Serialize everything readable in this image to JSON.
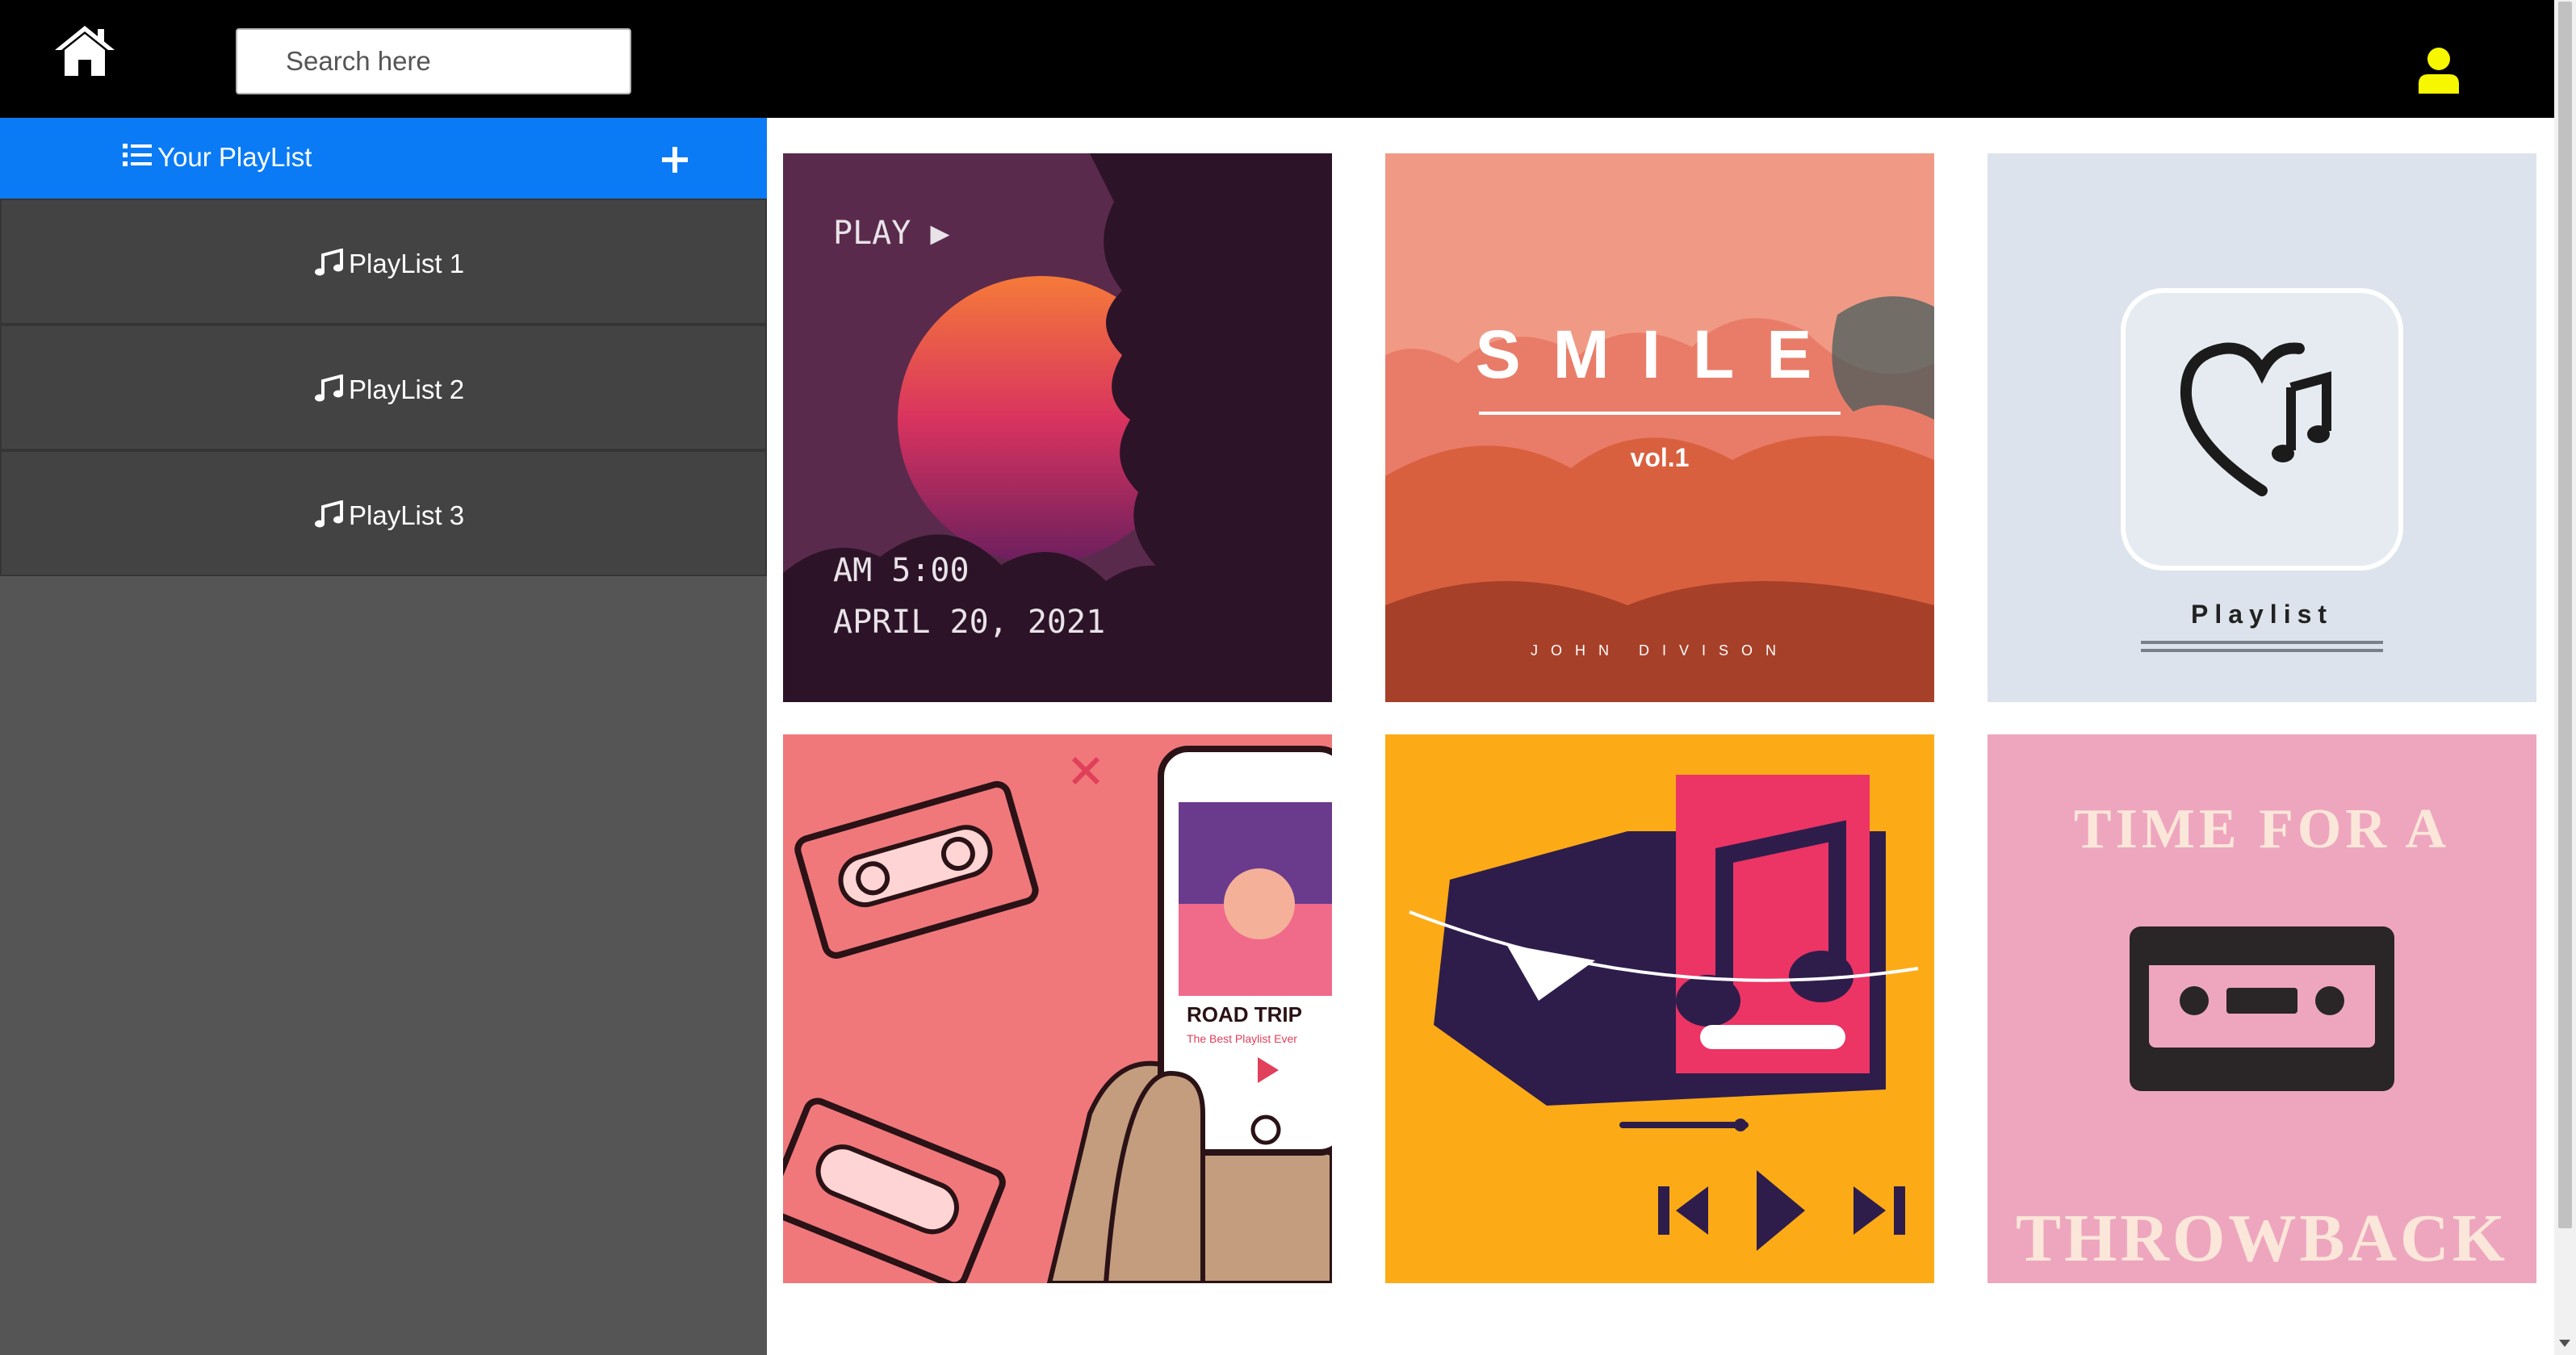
{
  "header": {
    "search_placeholder": "Search here",
    "home_icon": "home-icon",
    "user_icon": "user-icon",
    "user_icon_color": "#f7f700"
  },
  "sidebar": {
    "header_label": "Your PlayList",
    "header_color": "#0a7bf5",
    "add_icon": "plus-icon",
    "items": [
      {
        "label": "PlayList 1",
        "icon": "music-note-icon"
      },
      {
        "label": "PlayList 2",
        "icon": "music-note-icon"
      },
      {
        "label": "PlayList 3",
        "icon": "music-note-icon"
      }
    ]
  },
  "covers": [
    {
      "name": "play-sunset-cover",
      "text": [
        "PLAY ▶",
        "AM 5:00",
        "APRIL 20, 2021"
      ]
    },
    {
      "name": "smile-cover",
      "text": [
        "SMILE",
        "vol.1",
        "JOHN DIVISON"
      ]
    },
    {
      "name": "playlist-heart-cover",
      "text": [
        "Playlist"
      ]
    },
    {
      "name": "road-trip-cover",
      "text": [
        "ROAD TRIP",
        "The Best Playlist Ever"
      ]
    },
    {
      "name": "music-player-cover",
      "text": []
    },
    {
      "name": "throwback-cover",
      "text": [
        "TIME FOR A",
        "THROWBACK"
      ]
    }
  ]
}
